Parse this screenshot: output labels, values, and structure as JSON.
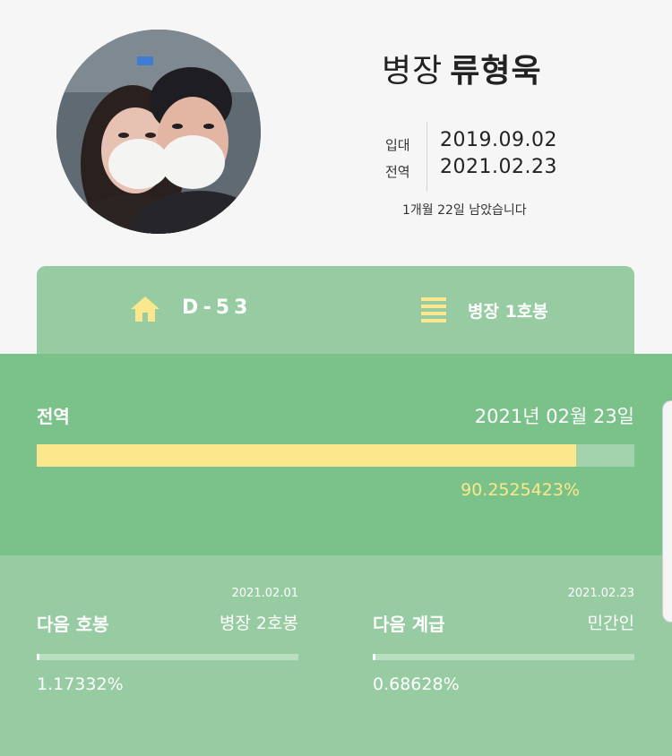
{
  "profile": {
    "rank": "병장",
    "name": "류형욱",
    "enlist_label": "입대",
    "enlist_date": "2019.09.02",
    "discharge_label": "전역",
    "discharge_date": "2021.02.23",
    "remaining_text": "1개월 22일 남았습니다"
  },
  "summary": {
    "home_icon": "home-icon",
    "dday": "D-53",
    "menu_icon": "menu-icon",
    "rank_step": "병장 1호봉",
    "accent_color": "#fbe88c"
  },
  "discharge": {
    "label": "전역",
    "date_text": "2021년 02월 23일",
    "progress": 90.2525423,
    "percent_text": "90.2525423%"
  },
  "next_step": {
    "date": "2021.02.01",
    "title": "다음 호봉",
    "value": "병장 2호봉",
    "progress": 1.17332,
    "percent_text": "1.17332%"
  },
  "next_rank": {
    "date": "2021.02.23",
    "title": "다음 계급",
    "value": "민간인",
    "progress": 0.68628,
    "percent_text": "0.68628%"
  },
  "colors": {
    "background": "#f6f6f6",
    "light_green": "#97cca2",
    "mid_green": "#7bc28a",
    "yellow": "#fbe88c"
  }
}
